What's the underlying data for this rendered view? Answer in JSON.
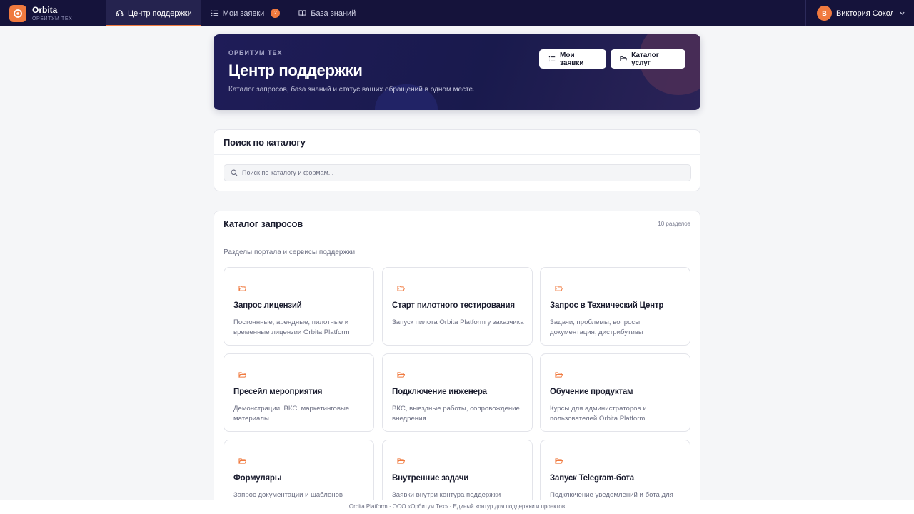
{
  "brand": {
    "name": "Orbita",
    "sub": "ОРБИТУМ ТЕХ"
  },
  "nav": [
    {
      "label": "Центр поддержки",
      "icon": "headset-icon",
      "active": true
    },
    {
      "label": "Мои заявки",
      "icon": "list-icon",
      "badge": "2"
    },
    {
      "label": "База знаний",
      "icon": "book-icon"
    }
  ],
  "user": {
    "initial": "В",
    "name": "Виктория Соколова"
  },
  "hero": {
    "eyebrow": "ОРБИТУМ ТЕХ",
    "title": "Центр поддержки",
    "description": "Каталог запросов, база знаний и статус ваших обращений в одном месте.",
    "btn_requests": "Мои заявки",
    "btn_catalog": "Каталог услуг"
  },
  "search": {
    "title": "Поиск по каталогу",
    "placeholder": "Поиск по каталогу и формам..."
  },
  "catalog": {
    "title": "Каталог запросов",
    "count": "10 разделов",
    "subtitle": "Разделы портала и сервисы поддержки",
    "items": [
      {
        "title": "Запрос лицензий",
        "desc": "Постоянные, арендные, пилотные и временные лицензии Orbita Platform"
      },
      {
        "title": "Старт пилотного тестирования",
        "desc": "Запуск пилота Orbita Platform у заказчика"
      },
      {
        "title": "Запрос в Технический Центр",
        "desc": "Задачи, проблемы, вопросы, документация, дистрибутивы"
      },
      {
        "title": "Пресейл мероприятия",
        "desc": "Демонстрации, ВКС, маркетинговые материалы"
      },
      {
        "title": "Подключение инженера",
        "desc": "ВКС, выездные работы, сопровождение внедрения"
      },
      {
        "title": "Обучение продуктам",
        "desc": "Курсы для администраторов и пользователей Orbita Platform"
      },
      {
        "title": "Формуляры",
        "desc": "Запрос документации и шаблонов"
      },
      {
        "title": "Внутренние задачи",
        "desc": "Заявки внутри контура поддержки"
      },
      {
        "title": "Запуск Telegram-бота",
        "desc": "Подключение уведомлений и бота для"
      }
    ]
  },
  "footer": "Orbita Platform · ООО «Орбитум Тех» · Единый контур для поддержки и проектов",
  "colors": {
    "accent": "#f07a3f",
    "topbar": "#15133b",
    "hero": "#1f1c58"
  }
}
